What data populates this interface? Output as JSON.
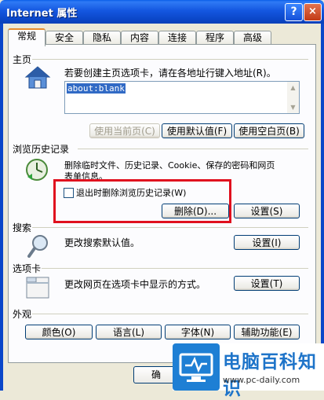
{
  "window": {
    "title": "Internet 属性",
    "help_label": "?",
    "close_label": "×"
  },
  "tabs": [
    {
      "label": "常规",
      "active": true
    },
    {
      "label": "安全"
    },
    {
      "label": "隐私"
    },
    {
      "label": "内容"
    },
    {
      "label": "连接"
    },
    {
      "label": "程序"
    },
    {
      "label": "高级"
    }
  ],
  "home": {
    "section_title": "主页",
    "description": "若要创建主页选项卡，请在各地址行键入地址(R)。",
    "value": "about:blank",
    "use_current": "使用当前页(C)",
    "use_default": "使用默认值(F)",
    "use_blank": "使用空白页(B)"
  },
  "history": {
    "section_title": "浏览历史记录",
    "description_line1": "删除临时文件、历史记录、Cookie、保存的密码和网页",
    "description_line2": "表单信息。",
    "delete_on_exit": "退出时删除浏览历史记录(W)",
    "delete_on_exit_checked": false,
    "delete_button": "删除(D)...",
    "settings_button": "设置(S)"
  },
  "search": {
    "section_title": "搜索",
    "description": "更改搜索默认值。",
    "settings_button": "设置(I)"
  },
  "tabs_section": {
    "section_title": "选项卡",
    "description": "更改网页在选项卡中显示的方式。",
    "settings_button": "设置(T)"
  },
  "appearance": {
    "section_title": "外观",
    "colors": "颜色(O)",
    "languages": "语言(L)",
    "fonts": "字体(N)",
    "accessibility": "辅助功能(E)"
  },
  "footer": {
    "ok_partial": "确"
  },
  "watermark": {
    "name": "电脑百科知识",
    "url": "www.pc-daily.com"
  },
  "colors": {
    "titlebar": "#0b47c9",
    "highlight_box": "#e0101e",
    "selection": "#316ac5"
  }
}
